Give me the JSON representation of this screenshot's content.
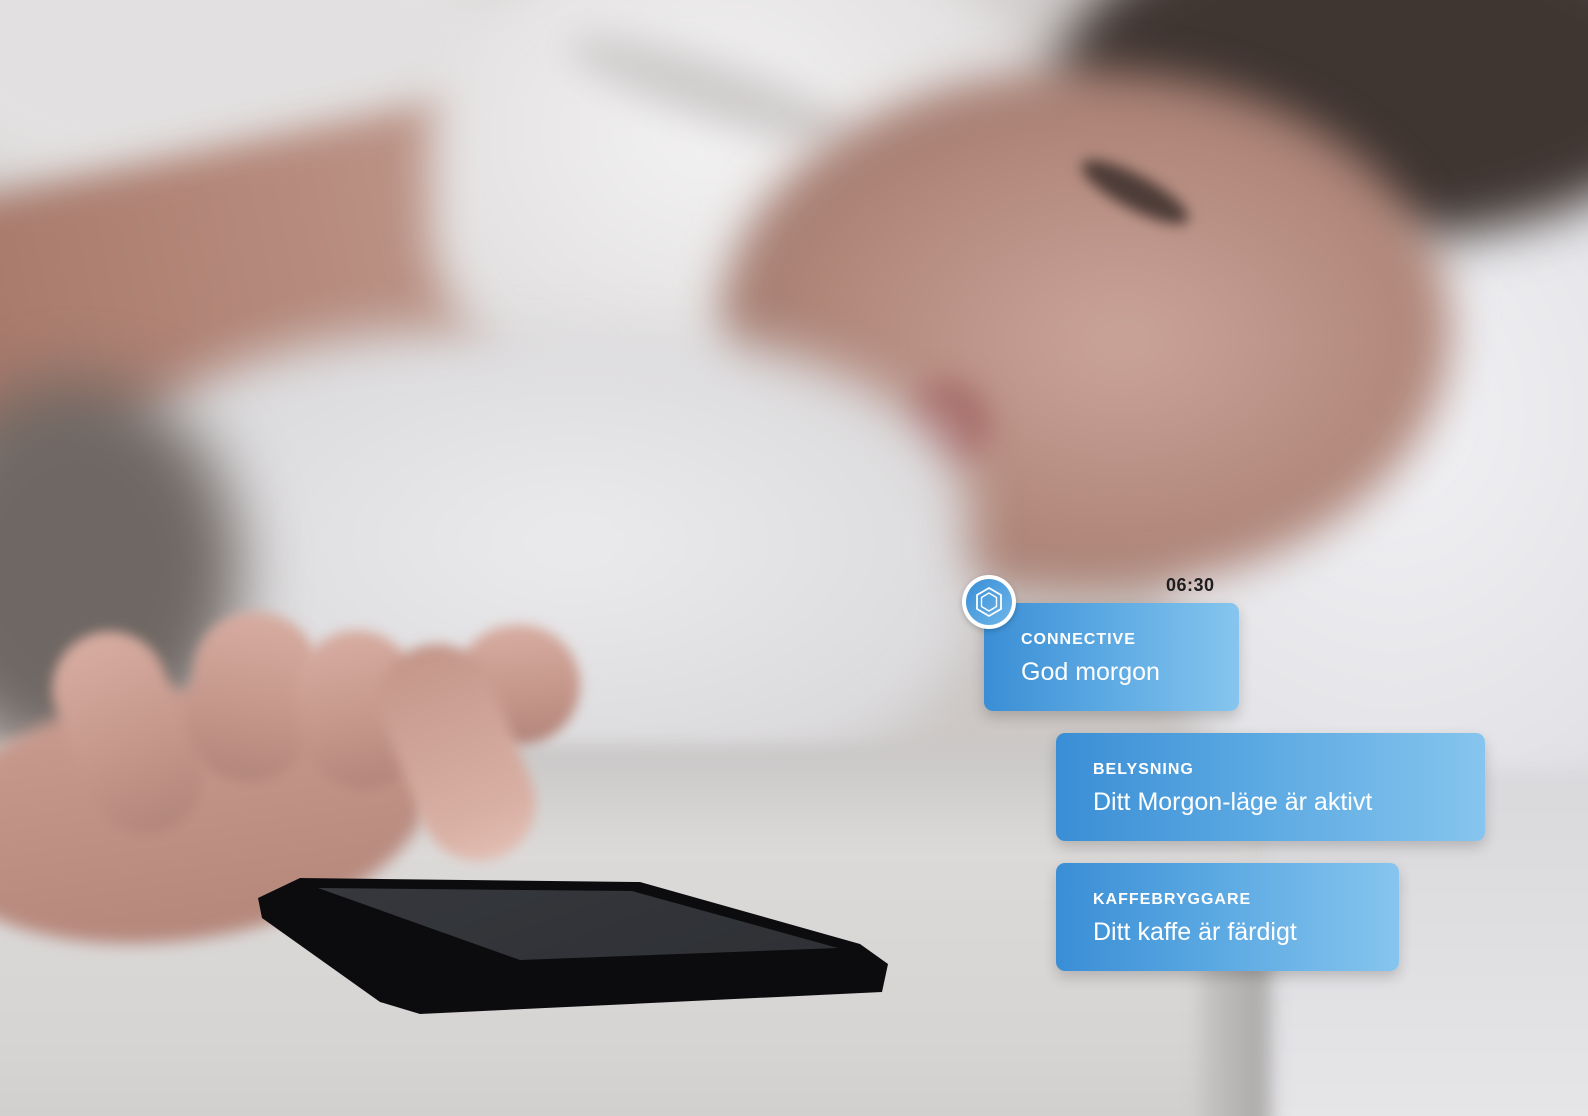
{
  "status": {
    "time": "06:30"
  },
  "app_icon": "hexagon-icon",
  "notifications": [
    {
      "app": "CONNECTIVE",
      "message": "God morgon"
    },
    {
      "app": "BELYSNING",
      "message": "Ditt Morgon-läge är aktivt"
    },
    {
      "app": "KAFFEBRYGGARE",
      "message": "Ditt kaffe är färdigt"
    }
  ],
  "colors": {
    "card_gradient_start": "#3a8ed5",
    "card_gradient_end": "#86c5ee",
    "card_text": "#ffffff",
    "time_text": "#1d1d1f"
  }
}
